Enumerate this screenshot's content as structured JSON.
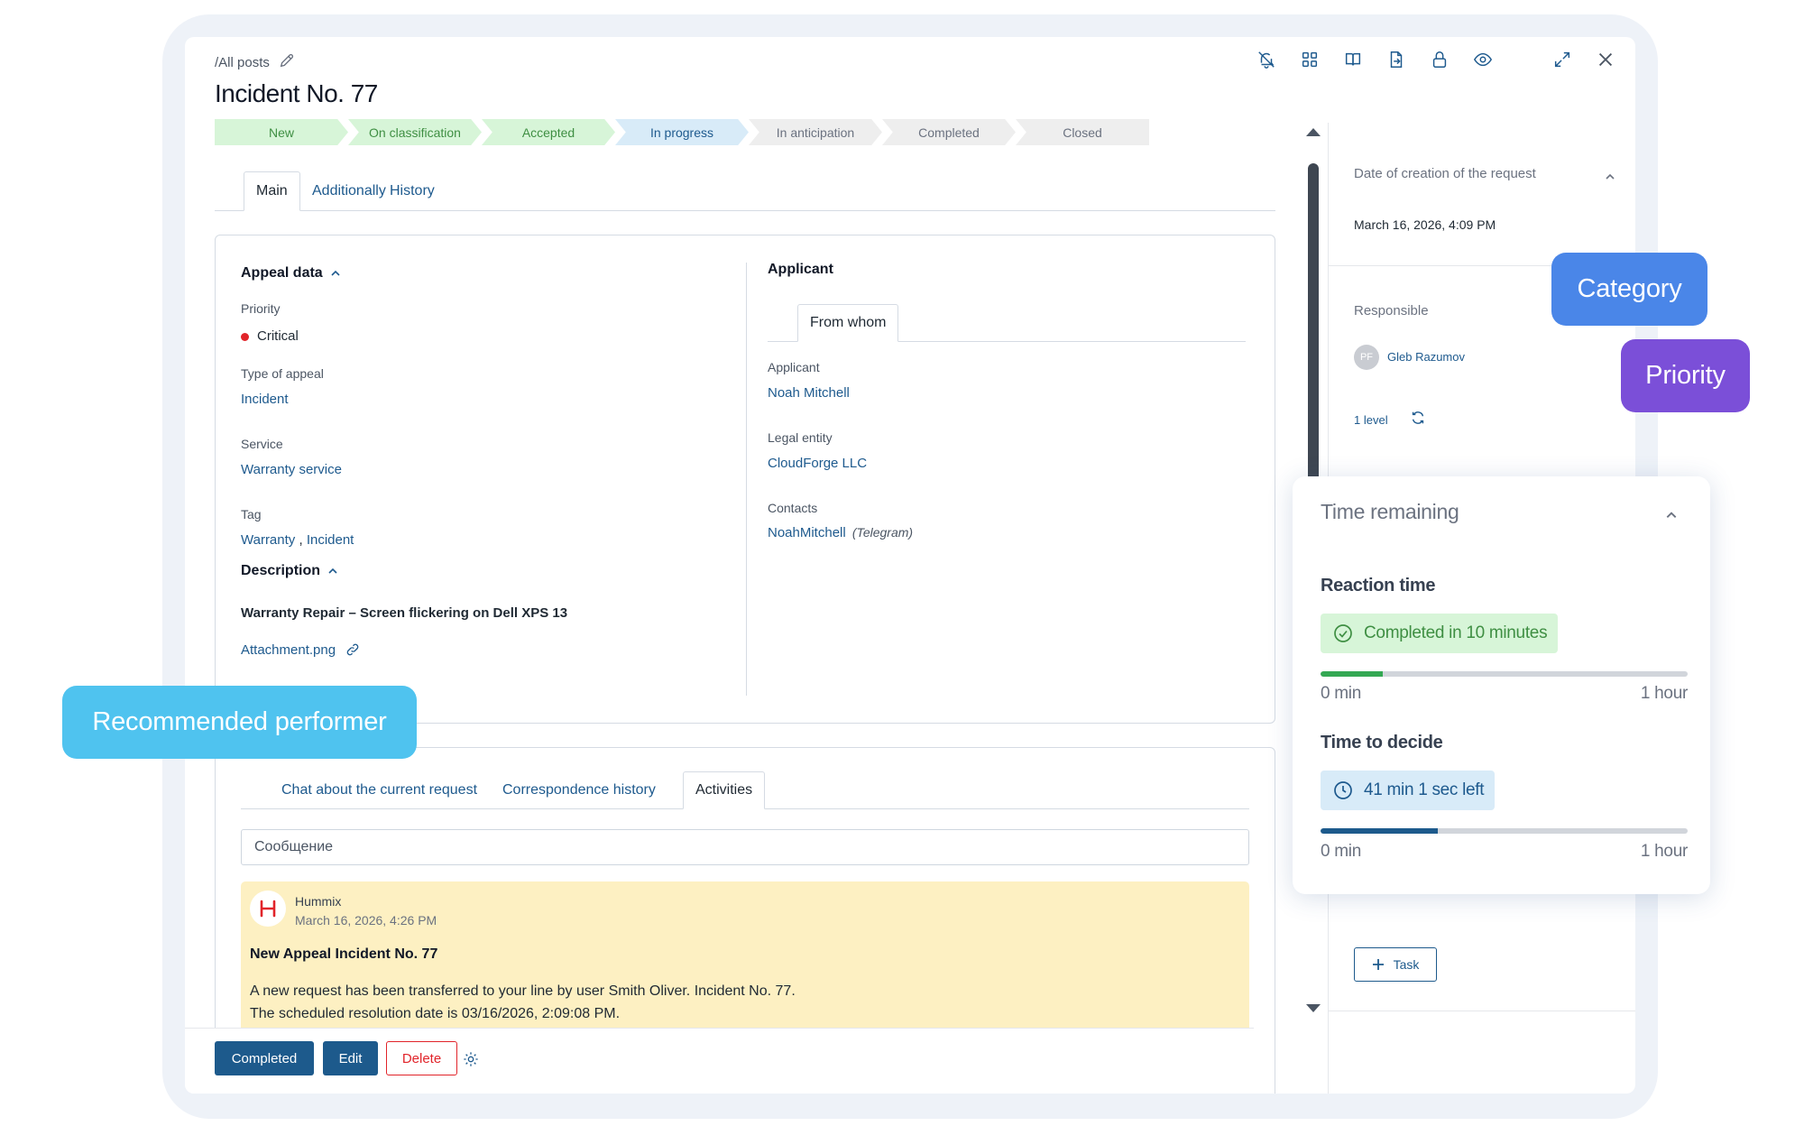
{
  "header": {
    "breadcrumb": "/All posts",
    "title": "Incident No. 77"
  },
  "toolbar": [
    "bell-off-icon",
    "grid-icon",
    "book-icon",
    "file-export-icon",
    "lock-icon",
    "eye-icon",
    "expand-icon",
    "close-icon"
  ],
  "stages": [
    {
      "label": "New",
      "state": "done"
    },
    {
      "label": "On classification",
      "state": "done"
    },
    {
      "label": "Accepted",
      "state": "done"
    },
    {
      "label": "In progress",
      "state": "active"
    },
    {
      "label": "In anticipation",
      "state": "todo"
    },
    {
      "label": "Completed",
      "state": "todo"
    },
    {
      "label": "Closed",
      "state": "todo"
    }
  ],
  "tabs": {
    "main": "Main",
    "additionally": "Additionally",
    "history": "History"
  },
  "appeal": {
    "title": "Appeal data",
    "priority_label": "Priority",
    "priority_value": "Critical",
    "type_label": "Type of appeal",
    "type_value": "Incident",
    "service_label": "Service",
    "service_value": "Warranty service",
    "tag_label": "Tag",
    "tag_value_1": "Warranty",
    "tag_sep": " , ",
    "tag_value_2": "Incident"
  },
  "description": {
    "title": "Description",
    "text": "Warranty Repair – Screen flickering on Dell XPS 13",
    "attachment": "Attachment.png"
  },
  "applicant": {
    "title": "Applicant",
    "subtab": "From whom",
    "applicant_label": "Applicant",
    "applicant_value": "Noah Mitchell",
    "legal_label": "Legal entity",
    "legal_value": "CloudForge LLC",
    "contacts_label": "Contacts",
    "contacts_value": "NoahMitchell",
    "contacts_channel": "(Telegram)"
  },
  "chat": {
    "tab_chat": "Chat about the current request",
    "tab_history": "Correspondence history",
    "tab_activities": "Activities",
    "placeholder": "Сообщение",
    "message": {
      "author": "Hummix",
      "date": "March 16, 2026, 4:26 PM",
      "title": "New Appeal Incident No. 77",
      "line1": "A new request has been transferred to your line by user Smith Oliver. Incident No. 77.",
      "line2": "The scheduled resolution date is 03/16/2026, 2:09:08 PM."
    }
  },
  "footer": {
    "completed": "Completed",
    "edit": "Edit",
    "delete": "Delete"
  },
  "side": {
    "created_title": "Date of creation of the request",
    "created_value": "March 16, 2026, 4:09 PM",
    "responsible_title": "Responsible",
    "avatar_initials": "PF",
    "responsible_value": "Gleb Razumov",
    "level": "1 level",
    "task_button": "Task"
  },
  "time_remaining": {
    "title": "Time remaining",
    "reaction_title": "Reaction time",
    "reaction_badge": "Completed in 10 minutes",
    "reaction_progress": 0.17,
    "decide_title": "Time to decide",
    "decide_badge": "41 min 1 sec left",
    "decide_progress": 0.32,
    "min_label": "0 min",
    "max_label": "1 hour"
  },
  "callouts": {
    "category": "Category",
    "priority": "Priority",
    "recommended": "Recommended performer"
  },
  "colors": {
    "accent": "#1d5a8c",
    "link": "#1e5a8e",
    "critical": "#e1242a",
    "done_bg": "#d7f5d8",
    "done_text": "#3f8f43",
    "active_bg": "#d8ebf8",
    "category_callout": "#4a86e8",
    "priority_callout": "#7b4fd8",
    "recommended_callout": "#4fc3ef",
    "reaction_fill": "#34a853",
    "decide_fill": "#1d5a8c"
  }
}
